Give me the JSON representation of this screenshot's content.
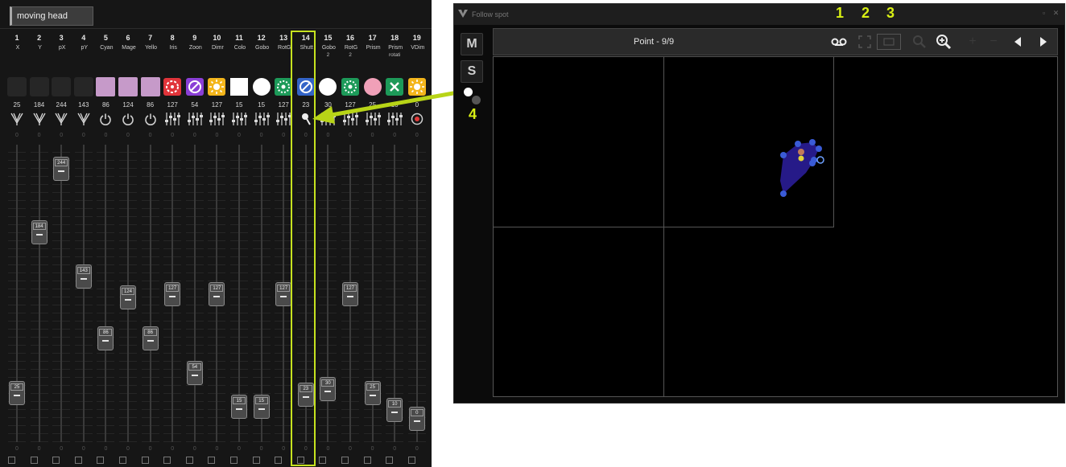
{
  "mixer": {
    "tab_label": "moving head",
    "channels": [
      {
        "num": "1",
        "name": "X",
        "name2": "",
        "value": "25",
        "icon": "fan-icon",
        "chip": "",
        "handle_pos": 0.866,
        "zero": "0"
      },
      {
        "num": "2",
        "name": "Y",
        "name2": "",
        "value": "184",
        "icon": "fan-icon",
        "chip": "",
        "handle_pos": 0.277,
        "zero": "0"
      },
      {
        "num": "3",
        "name": "pX",
        "name2": "",
        "value": "244",
        "icon": "fan-icon",
        "chip": "",
        "handle_pos": 0.043,
        "zero": "0"
      },
      {
        "num": "4",
        "name": "pY",
        "name2": "",
        "value": "143",
        "icon": "fan-icon",
        "chip": "",
        "handle_pos": 0.438,
        "zero": "0"
      },
      {
        "num": "5",
        "name": "Cyan",
        "name2": "",
        "value": "86",
        "icon": "power-icon",
        "chip": "lilac",
        "handle_pos": 0.665,
        "zero": "0"
      },
      {
        "num": "6",
        "name": "Mage",
        "name2": "",
        "value": "124",
        "icon": "power-icon",
        "chip": "lilac",
        "handle_pos": 0.516,
        "zero": "0"
      },
      {
        "num": "7",
        "name": "Yello",
        "name2": "",
        "value": "86",
        "icon": "power-icon",
        "chip": "lilac",
        "handle_pos": 0.665,
        "zero": "0"
      },
      {
        "num": "8",
        "name": "Iris",
        "name2": "",
        "value": "127",
        "icon": "sliders-icon",
        "chip": "iris",
        "handle_pos": 0.504,
        "zero": "0"
      },
      {
        "num": "9",
        "name": "Zoon",
        "name2": "",
        "value": "54",
        "icon": "sliders-icon",
        "chip": "zoom",
        "handle_pos": 0.79,
        "zero": "0"
      },
      {
        "num": "10",
        "name": "Dimr",
        "name2": "",
        "value": "127",
        "icon": "sliders-icon",
        "chip": "sun",
        "handle_pos": 0.504,
        "zero": "0"
      },
      {
        "num": "11",
        "name": "Colo",
        "name2": "",
        "value": "15",
        "icon": "sliders-icon",
        "chip": "white-square",
        "handle_pos": 0.915,
        "zero": "0"
      },
      {
        "num": "12",
        "name": "Gobo",
        "name2": "",
        "value": "15",
        "icon": "sliders-icon",
        "chip": "white-circle",
        "handle_pos": 0.915,
        "zero": "0"
      },
      {
        "num": "13",
        "name": "RotG",
        "name2": "",
        "value": "127",
        "icon": "sliders-icon",
        "chip": "gobo-green",
        "handle_pos": 0.504,
        "zero": "0"
      },
      {
        "num": "14",
        "name": "Shutt",
        "name2": "",
        "value": "23",
        "icon": "follow-spot-icon",
        "chip": "shutter",
        "handle_pos": 0.872,
        "zero": "0"
      },
      {
        "num": "15",
        "name": "Gobo",
        "name2": "2",
        "value": "30",
        "icon": "sliders-icon",
        "chip": "white-circle",
        "handle_pos": 0.849,
        "zero": "0"
      },
      {
        "num": "16",
        "name": "RotG",
        "name2": "2",
        "value": "127",
        "icon": "sliders-icon",
        "chip": "gobo-green",
        "handle_pos": 0.504,
        "zero": "0"
      },
      {
        "num": "17",
        "name": "Prism",
        "name2": "",
        "value": "25",
        "icon": "sliders-icon",
        "chip": "pink-circle",
        "handle_pos": 0.866,
        "zero": "0"
      },
      {
        "num": "18",
        "name": "Prism",
        "name2": "rotati",
        "value": "10",
        "icon": "sliders-icon",
        "chip": "x-green",
        "handle_pos": 0.927,
        "zero": "0"
      },
      {
        "num": "19",
        "name": "VDim",
        "name2": "",
        "value": "0",
        "icon": "record-icon",
        "chip": "sun",
        "handle_pos": 0.96,
        "zero": "0"
      }
    ]
  },
  "follow_spot": {
    "title": "Follow spot",
    "side_buttons": {
      "m": "M",
      "s": "S"
    },
    "point_label": "Point - 9/9",
    "toolbar_icons": [
      "record-loop-icon",
      "fit-icon",
      "frame-icon",
      "zoom-out-icon",
      "zoom-in-icon",
      "add-point-icon",
      "remove-point-icon",
      "prev-arrow-icon",
      "next-arrow-icon"
    ]
  },
  "callouts": {
    "c1": "1",
    "c2": "2",
    "c3": "3",
    "c4": "4"
  },
  "colors": {
    "accent": "#c6e21f",
    "lilac": "#c69ac9",
    "shape_fill": "#2d1fa0",
    "shape_point": "#3a5bd6"
  }
}
